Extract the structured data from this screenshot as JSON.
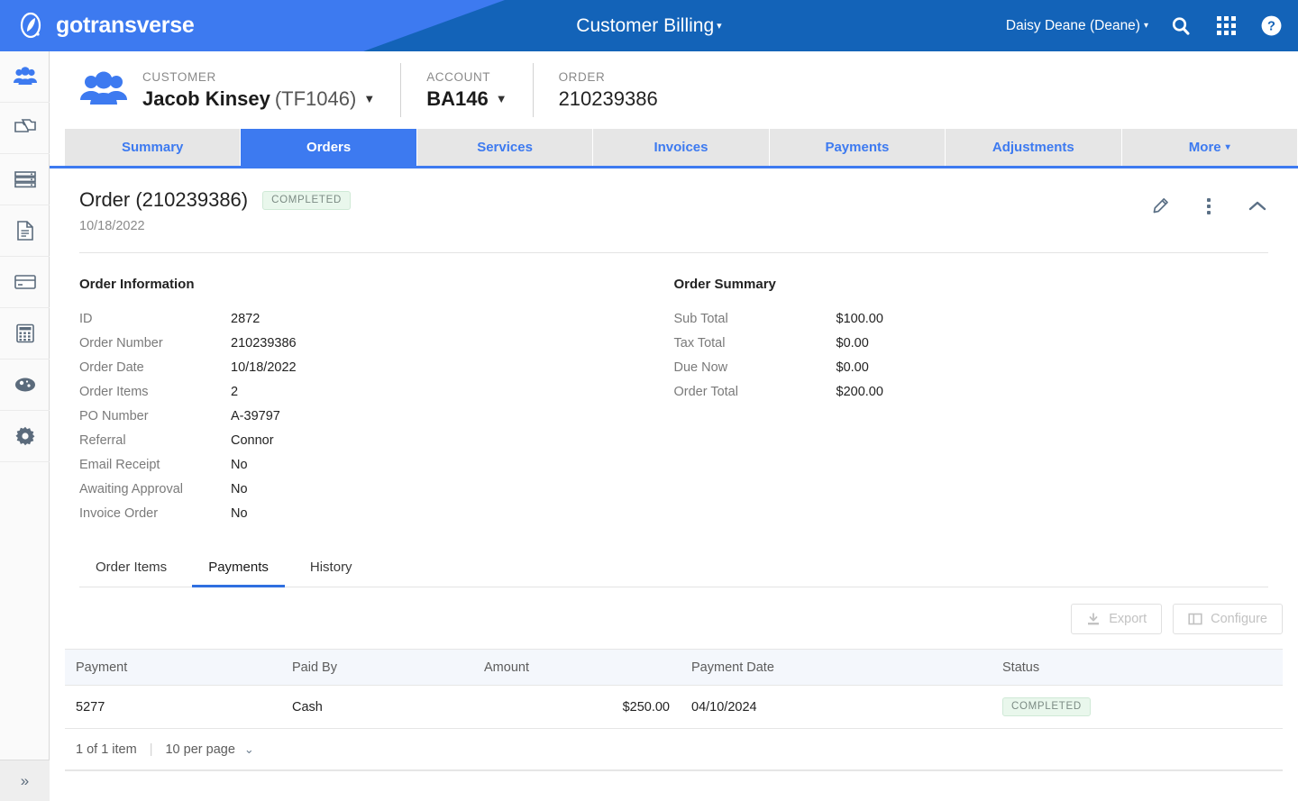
{
  "topbar": {
    "brand": "gotransverse",
    "logo_icon": "gotransverse-logo-icon",
    "app_title": "Customer Billing",
    "app_title_caret": "▾",
    "user": "Daisy Deane (Deane)",
    "user_caret": "▾",
    "search_icon": "search-icon",
    "apps_icon": "apps-grid-icon",
    "help_icon": "help-circle-icon",
    "bg_color": "#1363b8",
    "accent_color": "#3d7af0"
  },
  "sidebar": {
    "items": [
      {
        "icon": "customers-people-icon",
        "active": true
      },
      {
        "icon": "products-copy-icon",
        "active": false
      },
      {
        "icon": "servers-stack-icon",
        "active": false
      },
      {
        "icon": "document-invoice-icon",
        "active": false
      },
      {
        "icon": "credit-card-icon",
        "active": false
      },
      {
        "icon": "calculator-icon",
        "active": false
      },
      {
        "icon": "dashboard-gauge-icon",
        "active": false
      },
      {
        "icon": "settings-gear-icon",
        "active": false
      }
    ],
    "expand_icon": "»"
  },
  "context": {
    "people_icon": "customers-people-icon",
    "customer_label": "CUSTOMER",
    "customer_name": "Jacob Kinsey",
    "customer_code": "(TF1046)",
    "customer_caret": "▼",
    "account_label": "ACCOUNT",
    "account_value": "BA146",
    "account_caret": "▼",
    "order_label": "ORDER",
    "order_value": "210239386"
  },
  "tabs": [
    {
      "label": "Summary",
      "active": false
    },
    {
      "label": "Orders",
      "active": true
    },
    {
      "label": "Services",
      "active": false
    },
    {
      "label": "Invoices",
      "active": false
    },
    {
      "label": "Payments",
      "active": false
    },
    {
      "label": "Adjustments",
      "active": false
    },
    {
      "label": "More",
      "active": false,
      "caret": "▾"
    }
  ],
  "order_header": {
    "title": "Order (210239386)",
    "status_badge": "COMPLETED",
    "date": "10/18/2022",
    "edit_icon": "pencil-edit-icon",
    "menu_icon": "kebab-menu-icon",
    "collapse_icon": "chevron-up-icon"
  },
  "order_information": {
    "heading": "Order Information",
    "rows": [
      {
        "label": "ID",
        "value": "2872"
      },
      {
        "label": "Order Number",
        "value": "210239386"
      },
      {
        "label": "Order Date",
        "value": "10/18/2022"
      },
      {
        "label": "Order Items",
        "value": "2"
      },
      {
        "label": "PO Number",
        "value": "A-39797"
      },
      {
        "label": "Referral",
        "value": "Connor"
      },
      {
        "label": "Email Receipt",
        "value": "No"
      },
      {
        "label": "Awaiting Approval",
        "value": "No"
      },
      {
        "label": "Invoice Order",
        "value": "No"
      }
    ]
  },
  "order_summary": {
    "heading": "Order Summary",
    "rows": [
      {
        "label": "Sub Total",
        "value": "$100.00"
      },
      {
        "label": "Tax Total",
        "value": "$0.00"
      },
      {
        "label": "Due Now",
        "value": "$0.00"
      },
      {
        "label": "Order Total",
        "value": "$200.00"
      }
    ]
  },
  "subtabs": [
    {
      "label": "Order Items",
      "active": false
    },
    {
      "label": "Payments",
      "active": true
    },
    {
      "label": "History",
      "active": false
    }
  ],
  "grid_toolbar": {
    "export_label": "Export",
    "export_icon": "download-export-icon",
    "configure_label": "Configure",
    "configure_icon": "columns-configure-icon"
  },
  "payments_table": {
    "columns": [
      "Payment",
      "Paid By",
      "Amount",
      "Payment Date",
      "Status"
    ],
    "rows": [
      {
        "payment": "5277",
        "paid_by": "Cash",
        "amount": "$250.00",
        "payment_date": "04/10/2024",
        "status": "COMPLETED"
      }
    ],
    "footer": {
      "count": "1 of 1 item",
      "separator": "|",
      "per_page": "10 per page",
      "per_page_caret": "⌄"
    }
  }
}
